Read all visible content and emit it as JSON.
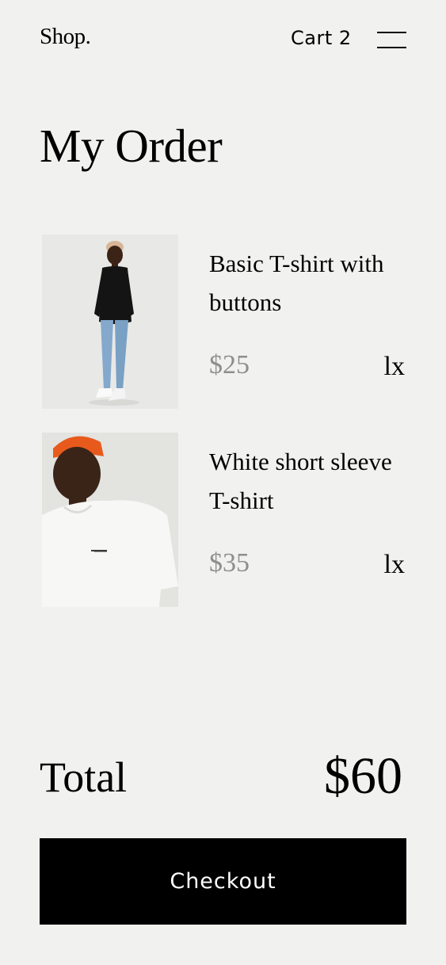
{
  "header": {
    "brand": "Shop.",
    "cart_label": "Cart 2",
    "menu_icon": "hamburger-menu-icon"
  },
  "page_title": "My Order",
  "order_items": [
    {
      "name": "Basic T-shirt with buttons",
      "price": "$25",
      "quantity": "lx",
      "image": "product-photo"
    },
    {
      "name": "White short sleeve T-shirt",
      "price": "$35",
      "quantity": "lx",
      "image": "product-photo"
    }
  ],
  "summary": {
    "total_label": "Total",
    "total_value": "$60"
  },
  "checkout_label": "Checkout",
  "colors": {
    "background": "#f1f1ef",
    "text": "#000000",
    "price_muted": "#8e8e8c",
    "button_bg": "#000000",
    "button_text": "#ffffff"
  }
}
